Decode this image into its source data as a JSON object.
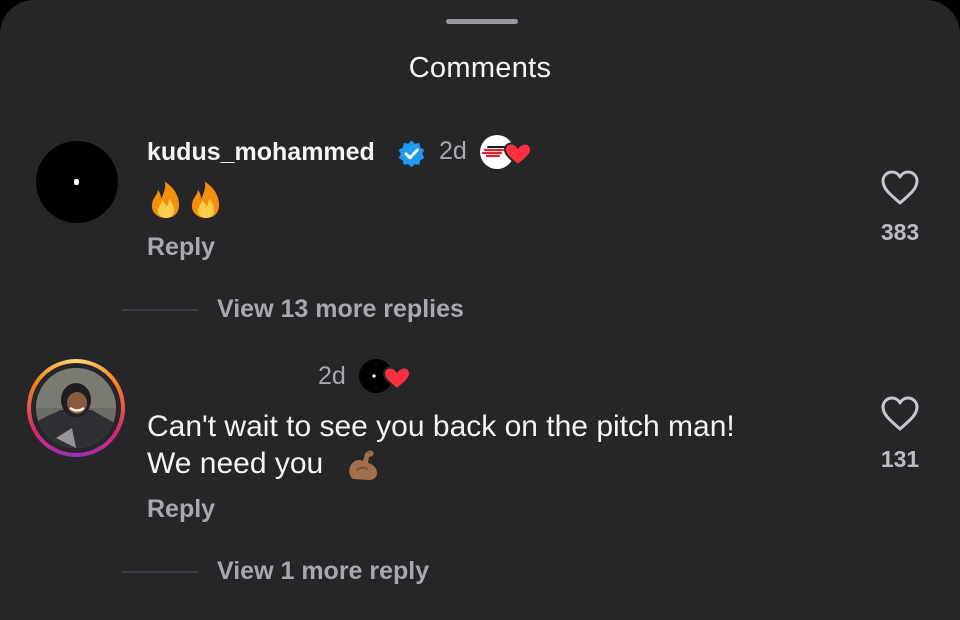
{
  "header": {
    "title": "Comments"
  },
  "comments": [
    {
      "username": "kudus_mohammed",
      "verified": true,
      "time": "2d",
      "text_emoji": "🔥🔥",
      "reply_label": "Reply",
      "likes": "383",
      "view_replies": "View 13 more replies",
      "creator_liked": true
    },
    {
      "username": "",
      "time": "2d",
      "text_line1": "Can't wait to see you back on the pitch man!",
      "text_line2": "We need you",
      "reply_label": "Reply",
      "likes": "131",
      "view_replies": "View 1 more reply",
      "creator_liked": true
    }
  ],
  "colors": {
    "sheet": "#262629",
    "text_primary": "#f5f5f5",
    "text_secondary": "#a8a8ad",
    "verified_blue": "#1d9bf0",
    "liked_red": "#ff3040"
  },
  "icons": [
    "verified-badge-icon",
    "heart-outline-icon",
    "creator-liked-heart-icon",
    "fire-emoji",
    "flexed-biceps-emoji"
  ]
}
